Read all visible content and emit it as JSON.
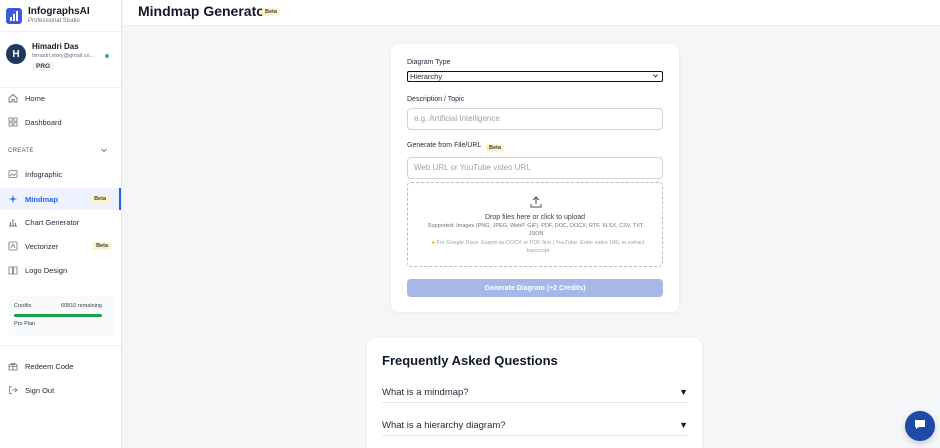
{
  "brand": {
    "name": "InfographsAI",
    "subtitle": "Professional Studio"
  },
  "user": {
    "initial": "H",
    "name": "Himadri Das",
    "email": "himadri.story@gmail.co...",
    "plan_badge": "PRO"
  },
  "sidebar": {
    "items_top": [
      {
        "label": "Home",
        "icon": "home-icon"
      },
      {
        "label": "Dashboard",
        "icon": "grid-icon"
      }
    ],
    "section_label": "CREATE",
    "create_items": [
      {
        "label": "Infographic",
        "icon": "image-icon",
        "badge": ""
      },
      {
        "label": "Mindmap",
        "icon": "sparkle-icon",
        "badge": "Beta",
        "active": true
      },
      {
        "label": "Chart Generator",
        "icon": "bar-chart-icon",
        "badge": ""
      },
      {
        "label": "Vectorizer",
        "icon": "vector-icon",
        "badge": "Beta"
      },
      {
        "label": "Logo Design",
        "icon": "book-icon",
        "badge": ""
      }
    ],
    "credits": {
      "title": "Credits",
      "remaining": "60810 remaining",
      "plan": "Pro Plan",
      "fill_fraction": 1.0
    },
    "bottom_items": [
      {
        "label": "Redeem Code",
        "icon": "gift-icon"
      },
      {
        "label": "Sign Out",
        "icon": "sign-out-icon"
      }
    ]
  },
  "header": {
    "title": "Mindmap Generator",
    "badge": "Beta"
  },
  "form": {
    "diagram_type_label": "Diagram Type",
    "diagram_type_value": "Hierarchy",
    "description_label": "Description / Topic",
    "description_placeholder": "e.g. Artificial Intelligence",
    "file_label": "Generate from File/URL",
    "file_badge": "Beta",
    "url_placeholder": "Web URL or YouTube video URL",
    "drop_main": "Drop files here or click to upload",
    "drop_supported": "Supported: Images (PNG, JPEG, WebP, GIF), PDF, DOC, DOCX, RTF, XLSX, CSV, TXT, JSON",
    "drop_tip": "For Google Docs: Export as DOCX or PDF first | YouTube: Enter video URL to extract transcript",
    "generate_button": "Generate Diagram (+2 Credits)"
  },
  "faq": {
    "title": "Frequently Asked Questions",
    "items": [
      {
        "question": "What is a mindmap?"
      },
      {
        "question": "What is a hierarchy diagram?"
      }
    ]
  },
  "colors": {
    "accent": "#2563eb",
    "brand": "#3b5bdb",
    "beta_bg": "#fdf3c4",
    "button_disabled": "#a5b8e8",
    "chat_fab": "#1e4aa8"
  }
}
